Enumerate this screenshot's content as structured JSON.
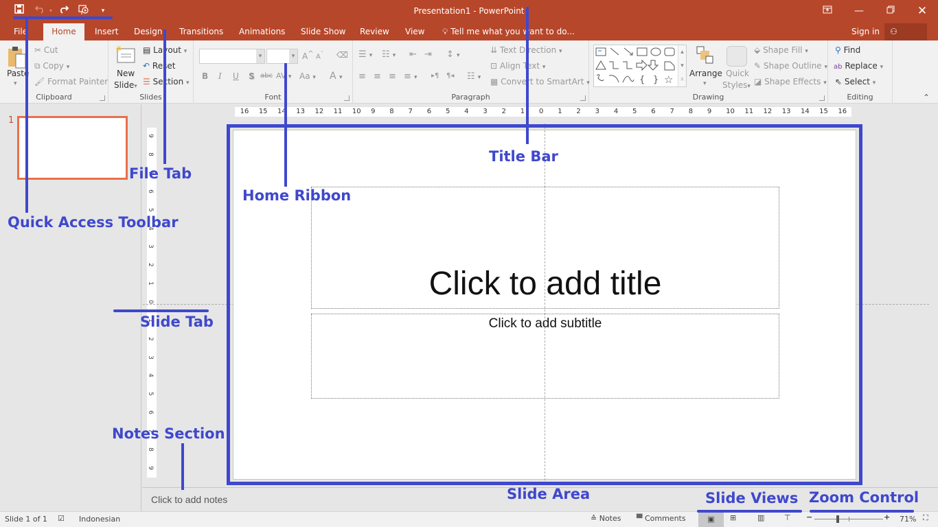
{
  "window": {
    "title": "Presentation1 - PowerPoint",
    "buttons": [
      "ribbon-display-options",
      "minimize",
      "restore",
      "close"
    ]
  },
  "qat": {
    "items": [
      {
        "name": "save",
        "icon": "save-icon"
      },
      {
        "name": "undo",
        "icon": "undo-icon"
      },
      {
        "name": "redo",
        "icon": "redo-icon"
      },
      {
        "name": "start-from-beginning",
        "icon": "slideshow-icon"
      },
      {
        "name": "customize",
        "icon": "dropdown-icon"
      }
    ]
  },
  "tabs": [
    "File",
    "Home",
    "Insert",
    "Design",
    "Transitions",
    "Animations",
    "Slide Show",
    "Review",
    "View"
  ],
  "active_tab": "Home",
  "tell_me": "Tell me what you want to do...",
  "sign_in": "Sign in",
  "share": "Share",
  "ribbon": {
    "clipboard": {
      "label": "Clipboard",
      "paste": "Paste",
      "cut": "Cut",
      "copy": "Copy",
      "format_painter": "Format Painter"
    },
    "slides": {
      "label": "Slides",
      "new_slide_1": "New",
      "new_slide_2": "Slide",
      "layout": "Layout",
      "reset": "Reset",
      "section": "Section"
    },
    "font": {
      "label": "Font",
      "font_name": "",
      "font_size": "",
      "bold": "B",
      "italic": "I",
      "underline": "U",
      "shadow": "S",
      "strike": "abc",
      "spacing": "AV",
      "case": "Aa",
      "color": "A",
      "grow": "A",
      "shrink": "A"
    },
    "paragraph": {
      "label": "Paragraph",
      "text_direction": "Text Direction",
      "align_text": "Align Text",
      "convert_smartart": "Convert to SmartArt"
    },
    "drawing": {
      "label": "Drawing",
      "arrange": "Arrange",
      "quick_styles_1": "Quick",
      "quick_styles_2": "Styles",
      "shape_fill": "Shape Fill",
      "shape_outline": "Shape Outline",
      "shape_effects": "Shape Effects"
    },
    "editing": {
      "label": "Editing",
      "find": "Find",
      "replace": "Replace",
      "select": "Select"
    }
  },
  "ruler": {
    "horizontal": [
      "16",
      "15",
      "14",
      "13",
      "12",
      "11",
      "10",
      "9",
      "8",
      "7",
      "6",
      "5",
      "4",
      "3",
      "2",
      "1",
      "0",
      "1",
      "2",
      "3",
      "4",
      "5",
      "6",
      "7",
      "8",
      "9",
      "10",
      "11",
      "12",
      "13",
      "14",
      "15",
      "16"
    ],
    "vertical": [
      "9",
      "8",
      "7",
      "6",
      "5",
      "4",
      "3",
      "2",
      "1",
      "0",
      "1",
      "2",
      "3",
      "4",
      "5",
      "6",
      "7",
      "8",
      "9"
    ]
  },
  "thumbnails": [
    {
      "number": "1"
    }
  ],
  "slide": {
    "title_placeholder": "Click to add title",
    "subtitle_placeholder": "Click to add subtitle"
  },
  "notes_placeholder": "Click to add notes",
  "status": {
    "slide_info": "Slide 1 of 1",
    "language": "Indonesian",
    "notes": "Notes",
    "comments": "Comments",
    "zoom": "71%",
    "zoom_percent": 71
  },
  "annotations": {
    "title_bar": "Title Bar",
    "file_tab": "File Tab",
    "home_ribbon": "Home Ribbon",
    "quick_access": "Quick Access Toolbar",
    "slide_tab": "Slide Tab",
    "notes_section": "Notes Section",
    "slide_area": "Slide Area",
    "slide_views": "Slide Views",
    "zoom_control": "Zoom Control"
  },
  "colors": {
    "brand": "#b7472a",
    "annotation": "#3f48cc",
    "thumb_border": "#e8704c"
  }
}
